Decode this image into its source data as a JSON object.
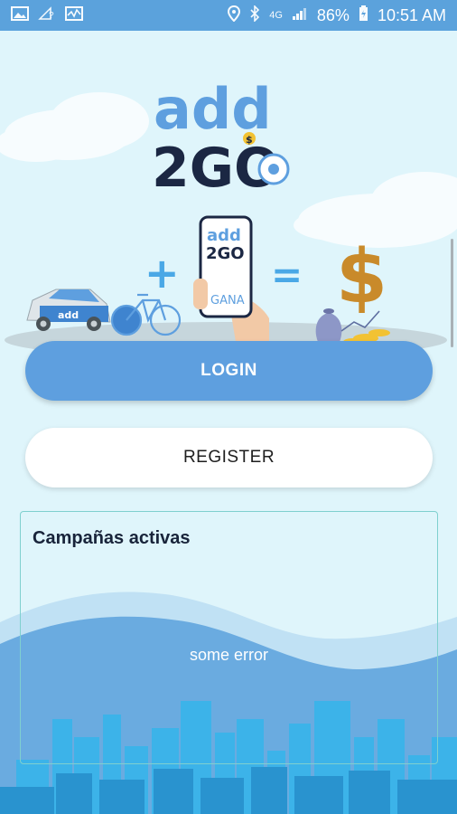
{
  "status_bar": {
    "battery": "86%",
    "time": "10:51 AM",
    "network": "4G",
    "icons": [
      "gallery-icon",
      "wifi-question-icon",
      "activity-icon",
      "location-icon",
      "bluetooth-icon",
      "signal-icon",
      "battery-icon"
    ]
  },
  "logo": {
    "line1": "add",
    "line2": "2GO",
    "badge": "$"
  },
  "illustration": {
    "car_label": "add",
    "phone_logo": "add",
    "phone_logo_2": "2GO",
    "phone_label": "GANA",
    "plus": "+",
    "equals": "=",
    "dollar": "$"
  },
  "buttons": {
    "login_label": "LOGIN",
    "register_label": "REGISTER"
  },
  "campaigns": {
    "title": "Campañas activas",
    "error": "some error"
  },
  "colors": {
    "primary": "#5e9fdf",
    "status_bar": "#5ba2dc",
    "background": "#dff5fb",
    "navy": "#18243a",
    "gold": "#c98a2a"
  }
}
